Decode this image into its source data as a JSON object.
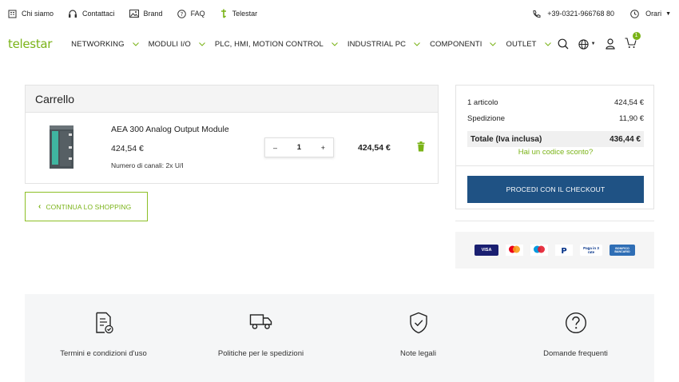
{
  "topbar": {
    "links": [
      {
        "label": "Chi siamo",
        "icon": "building-icon"
      },
      {
        "label": "Contattaci",
        "icon": "headset-icon"
      },
      {
        "label": "Brand",
        "icon": "image-icon"
      },
      {
        "label": "FAQ",
        "icon": "question-circle-icon"
      },
      {
        "label": "Telestar",
        "icon": "telestar-mark-icon"
      }
    ],
    "phone": "+39-0321-966768 80",
    "hours_label": "Orari"
  },
  "nav": {
    "logo": "telestar",
    "items": [
      {
        "label": "NETWORKING"
      },
      {
        "label": "MODULI I/O"
      },
      {
        "label": "PLC, HMI, MOTION CONTROL"
      },
      {
        "label": "INDUSTRIAL PC"
      },
      {
        "label": "COMPONENTI"
      },
      {
        "label": "OUTLET"
      }
    ],
    "cart_count": "1"
  },
  "cart": {
    "title": "Carrello",
    "item": {
      "name": "AEA 300 Analog Output Module",
      "price": "424,54 €",
      "attribute": "Numero di canali: 2x U/I",
      "quantity": "1",
      "minus": "–",
      "plus": "+",
      "total": "424,54 €"
    },
    "continue_label": "CONTINUA LO SHOPPING"
  },
  "summary": {
    "items_label": "1 articolo",
    "items_value": "424,54 €",
    "shipping_label": "Spedizione",
    "shipping_value": "11,90 €",
    "total_label": "Totale (Iva inclusa)",
    "total_value": "436,44 €",
    "coupon_label": "Hai un codice sconto?",
    "checkout_label": "PROCEDI CON IL CHECKOUT"
  },
  "payments": {
    "visa": "VISA",
    "paypal_later": "Paga in 3 rate",
    "bank": "BONIFICO BANCARIO"
  },
  "footer": {
    "items": [
      {
        "label": "Termini e condizioni d'uso",
        "icon": "document-check-icon"
      },
      {
        "label": "Politiche per le spedizioni",
        "icon": "truck-icon"
      },
      {
        "label": "Note legali",
        "icon": "shield-check-icon"
      },
      {
        "label": "Domande frequenti",
        "icon": "question-circle-icon"
      }
    ]
  },
  "colors": {
    "brand_green": "#7ab317",
    "checkout_blue": "#1f5284",
    "panel_gray": "#f4f4f4"
  }
}
